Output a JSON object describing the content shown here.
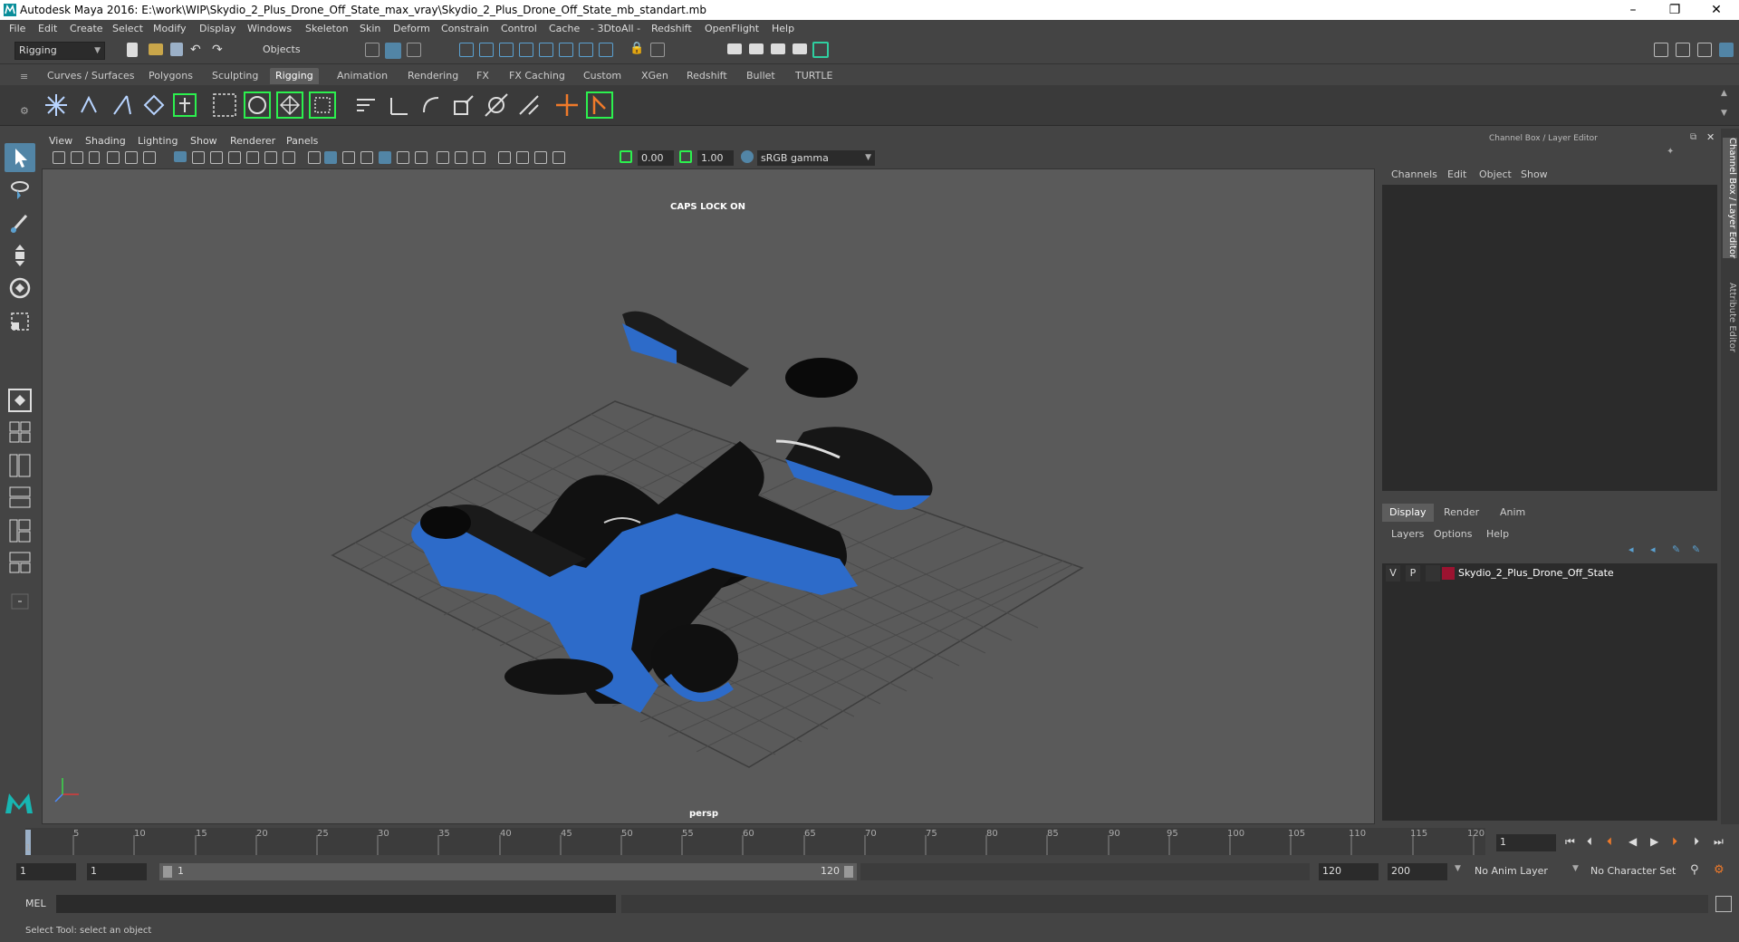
{
  "window": {
    "title": "Autodesk Maya 2016: E:\\work\\WIP\\Skydio_2_Plus_Drone_Off_State_max_vray\\Skydio_2_Plus_Drone_Off_State_mb_standart.mb",
    "minimize": "–",
    "maximize": "❐",
    "close": "✕"
  },
  "menubar": [
    "File",
    "Edit",
    "Create",
    "Select",
    "Modify",
    "Display",
    "Windows",
    "Skeleton",
    "Skin",
    "Deform",
    "Constrain",
    "Control",
    "Cache",
    "- 3DtoAll -",
    "Redshift",
    "OpenFlight",
    "Help"
  ],
  "statusline": {
    "menuset": "Rigging",
    "selection_mode": "Objects"
  },
  "shelf": {
    "tabs": [
      "Curves / Surfaces",
      "Polygons",
      "Sculpting",
      "Rigging",
      "Animation",
      "Rendering",
      "FX",
      "FX Caching",
      "Custom",
      "XGen",
      "Redshift",
      "Bullet",
      "TURTLE"
    ],
    "active": "Rigging"
  },
  "viewport": {
    "menus": [
      "View",
      "Shading",
      "Lighting",
      "Show",
      "Renderer",
      "Panels"
    ],
    "exposure": "0.00",
    "gamma": "1.00",
    "colorspace": "sRGB gamma",
    "caps_lock": "CAPS LOCK ON",
    "camera": "persp"
  },
  "channelbox": {
    "title": "Channel Box / Layer Editor",
    "menus": [
      "Channels",
      "Edit",
      "Object",
      "Show"
    ]
  },
  "layereditor": {
    "tabs": [
      "Display",
      "Render",
      "Anim"
    ],
    "active": "Display",
    "menus": [
      "Layers",
      "Options",
      "Help"
    ],
    "layers": [
      {
        "v": "V",
        "p": "P",
        "name": "Skydio_2_Plus_Drone_Off_State",
        "color": "#9b1330"
      }
    ]
  },
  "side_tabs": [
    "Channel Box / Layer Editor",
    "Attribute Editor"
  ],
  "timeslider": {
    "ticks": [
      "1",
      "5",
      "10",
      "15",
      "20",
      "25",
      "30",
      "35",
      "40",
      "45",
      "50",
      "55",
      "60",
      "65",
      "70",
      "75",
      "80",
      "85",
      "90",
      "95",
      "100",
      "105",
      "110",
      "115",
      "120"
    ],
    "current_frame": "1"
  },
  "range": {
    "start": "1",
    "playback_start": "1",
    "slider_start": "1",
    "slider_end": "120",
    "playback_end": "120",
    "end": "200",
    "anim_layer": "No Anim Layer",
    "character_set": "No Character Set"
  },
  "cmdline": {
    "lang": "MEL"
  },
  "helpline": {
    "text": "Select Tool: select an object"
  },
  "colors": {
    "accent": "#5285a6",
    "drone_blue": "#2d6bc9",
    "ui_bg": "#444444"
  }
}
